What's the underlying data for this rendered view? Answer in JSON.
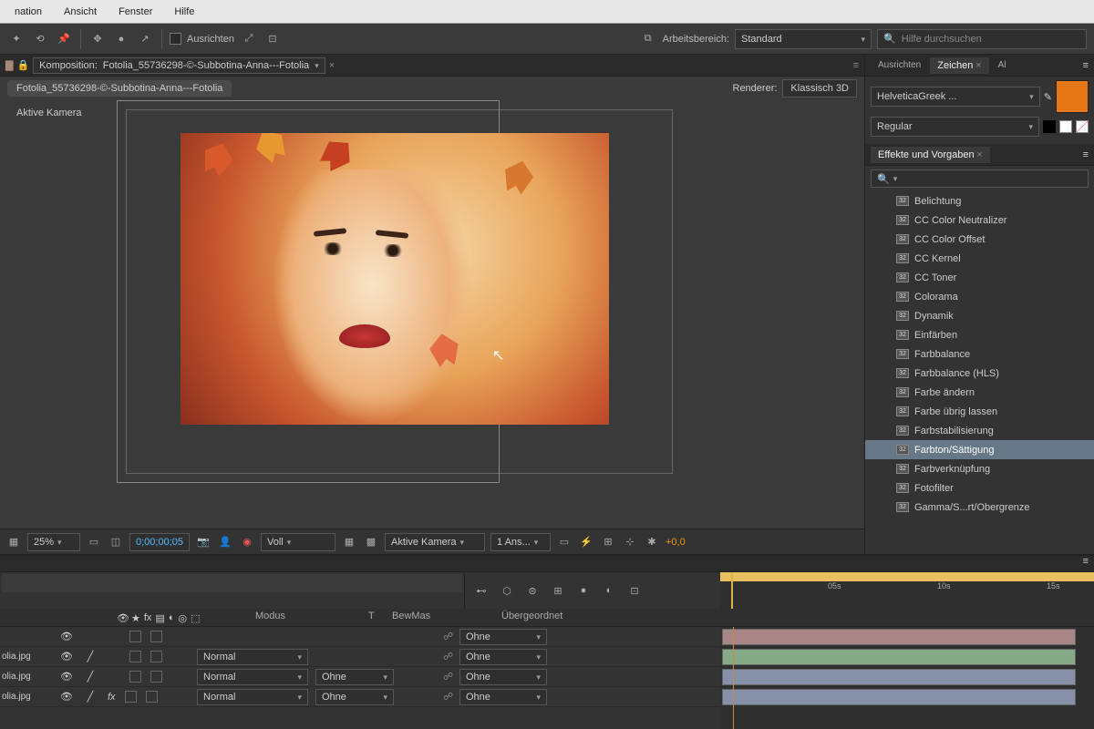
{
  "menubar": {
    "items": [
      "nation",
      "Ansicht",
      "Fenster",
      "Hilfe"
    ]
  },
  "toolbar": {
    "align_label": "Ausrichten",
    "workspace_label": "Arbeitsbereich:",
    "workspace_value": "Standard",
    "search_placeholder": "Hilfe durchsuchen"
  },
  "comp": {
    "prefix": "Komposition:",
    "name": "Fotolia_55736298-©-Subbotina-Anna---Fotolia",
    "renderer_label": "Renderer:",
    "renderer_value": "Klassisch 3D",
    "camera_label": "Aktive Kamera"
  },
  "viewer_footer": {
    "zoom": "25%",
    "timecode": "0;00;00;05",
    "resolution": "Voll",
    "camera": "Aktive Kamera",
    "views": "1 Ans...",
    "exp": "+0,0"
  },
  "panels": {
    "tabs": [
      "Ausrichten",
      "Zeichen",
      "Al"
    ],
    "active_tab": "Zeichen",
    "font_family": "HelveticaGreek ...",
    "font_style": "Regular",
    "effects_title": "Effekte und Vorgaben",
    "search_placeholder": "",
    "effects": [
      "Belichtung",
      "CC Color Neutralizer",
      "CC Color Offset",
      "CC Kernel",
      "CC Toner",
      "Colorama",
      "Dynamik",
      "Einfärben",
      "Farbbalance",
      "Farbbalance (HLS)",
      "Farbe ändern",
      "Farbe übrig lassen",
      "Farbstabilisierung",
      "Farbton/Sättigung",
      "Farbverknüpfung",
      "Fotofilter",
      "Gamma/S...rt/Obergrenze"
    ],
    "selected_effect": "Farbton/Sättigung",
    "color_swatch": "#e67817"
  },
  "timeline": {
    "columns": {
      "mode": "Modus",
      "t": "T",
      "bew": "BewMas",
      "parent": "Übergeordnet"
    },
    "ruler": [
      "05s",
      "10s",
      "15s"
    ],
    "none": "Ohne",
    "normal": "Normal",
    "layers": [
      {
        "name": "",
        "mode": "",
        "bew": "",
        "parent": "Ohne"
      },
      {
        "name": "olia.jpg",
        "mode": "Normal",
        "bew": "",
        "parent": "Ohne"
      },
      {
        "name": "olia.jpg",
        "mode": "Normal",
        "bew": "Ohne",
        "parent": "Ohne"
      },
      {
        "name": "olia.jpg",
        "mode": "Normal",
        "bew": "Ohne",
        "parent": "Ohne"
      }
    ]
  }
}
